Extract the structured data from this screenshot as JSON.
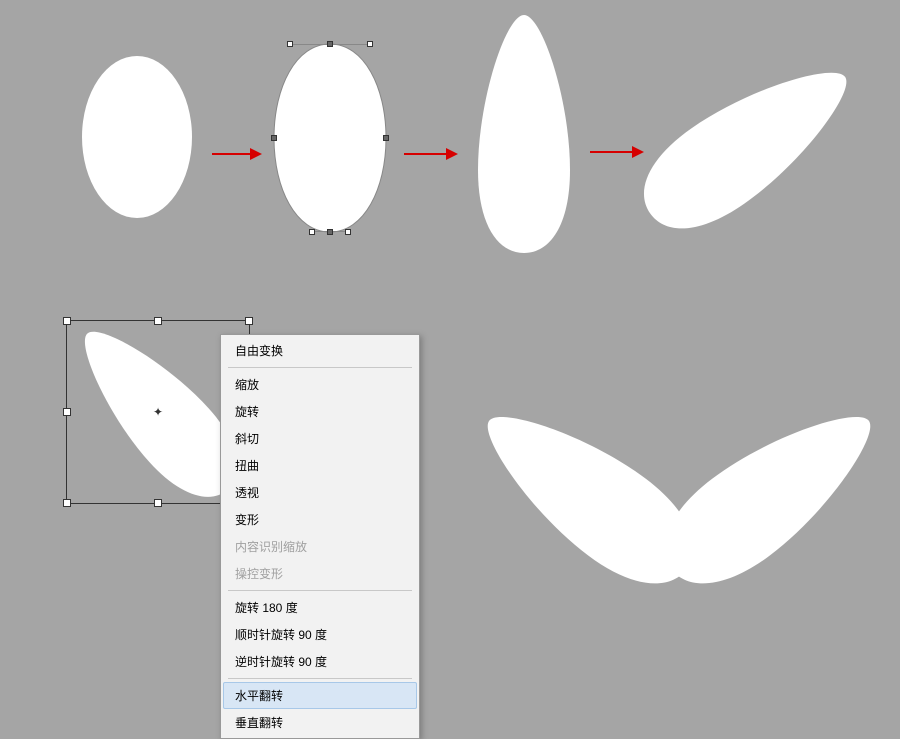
{
  "menu": {
    "free_transform": "自由变换",
    "scale": "缩放",
    "rotate": "旋转",
    "skew": "斜切",
    "distort": "扭曲",
    "perspective": "透视",
    "warp": "变形",
    "content_aware_scale": "内容识别缩放",
    "puppet_warp": "操控变形",
    "rotate_180": "旋转 180 度",
    "rotate_90_cw": "顺时针旋转 90 度",
    "rotate_90_ccw": "逆时针旋转 90 度",
    "flip_horizontal": "水平翻转",
    "flip_vertical": "垂直翻转"
  },
  "shapes": {
    "step1": "ellipse",
    "step2": "ellipse-editing",
    "step3": "teardrop",
    "step4": "teardrop-rotated",
    "bottom_left": "teardrop-selected",
    "bottom_right_a": "petal-left",
    "bottom_right_b": "petal-right"
  }
}
